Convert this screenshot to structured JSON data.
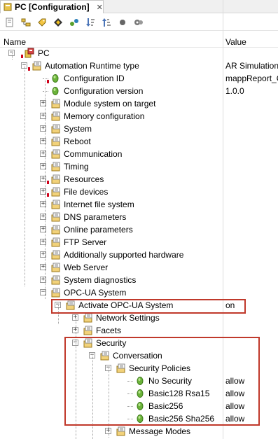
{
  "tab": {
    "title": "PC [Configuration]",
    "close": "✕"
  },
  "toolbar": {
    "icons": [
      "view-icon",
      "tree-icon",
      "tag-icon",
      "properties-icon",
      "connect-icon",
      "sort-down-icon",
      "sort-up-icon",
      "circle-icon",
      "gears-icon"
    ]
  },
  "columns": {
    "name": "Name",
    "value": "Value"
  },
  "rows": [
    {
      "label": "PC",
      "value": "",
      "depth": 0,
      "exp": "-",
      "icon": "pc"
    },
    {
      "label": "Automation Runtime type",
      "value": "AR Simulation",
      "depth": 2,
      "exp": "-",
      "icon": "folder"
    },
    {
      "label": "Configuration ID",
      "value": "mappReport_Co",
      "depth": 3,
      "exp": "",
      "icon": "green"
    },
    {
      "label": "Configuration version",
      "value": "1.0.0",
      "depth": 3,
      "exp": "",
      "icon": "green"
    },
    {
      "label": "Module system on target",
      "value": "",
      "depth": 3,
      "exp": "+",
      "icon": "folder"
    },
    {
      "label": "Memory configuration",
      "value": "",
      "depth": 3,
      "exp": "+",
      "icon": "folder"
    },
    {
      "label": "System",
      "value": "",
      "depth": 3,
      "exp": "+",
      "icon": "folder"
    },
    {
      "label": "Reboot",
      "value": "",
      "depth": 3,
      "exp": "+",
      "icon": "folder"
    },
    {
      "label": "Communication",
      "value": "",
      "depth": 3,
      "exp": "+",
      "icon": "folder"
    },
    {
      "label": "Timing",
      "value": "",
      "depth": 3,
      "exp": "+",
      "icon": "folder"
    },
    {
      "label": "Resources",
      "value": "",
      "depth": 3,
      "exp": "+",
      "icon": "folder"
    },
    {
      "label": "File devices",
      "value": "",
      "depth": 3,
      "exp": "+",
      "icon": "folder"
    },
    {
      "label": "Internet file system",
      "value": "",
      "depth": 3,
      "exp": "+",
      "icon": "folder"
    },
    {
      "label": "DNS parameters",
      "value": "",
      "depth": 3,
      "exp": "+",
      "icon": "folder"
    },
    {
      "label": "Online parameters",
      "value": "",
      "depth": 3,
      "exp": "+",
      "icon": "folder"
    },
    {
      "label": "FTP Server",
      "value": "",
      "depth": 3,
      "exp": "+",
      "icon": "folder"
    },
    {
      "label": "Additionally supported hardware",
      "value": "",
      "depth": 3,
      "exp": "+",
      "icon": "folder"
    },
    {
      "label": "Web Server",
      "value": "",
      "depth": 3,
      "exp": "+",
      "icon": "folder"
    },
    {
      "label": "System diagnostics",
      "value": "",
      "depth": 3,
      "exp": "+",
      "icon": "folder"
    },
    {
      "label": "OPC-UA System",
      "value": "",
      "depth": 3,
      "exp": "-",
      "icon": "folder"
    },
    {
      "label": "Activate OPC-UA System",
      "value": "on",
      "depth": 4,
      "exp": "-",
      "icon": "folder"
    },
    {
      "label": "Network Settings",
      "value": "",
      "depth": 5,
      "exp": "+",
      "icon": "folder"
    },
    {
      "label": "Facets",
      "value": "",
      "depth": 5,
      "exp": "+",
      "icon": "folder"
    },
    {
      "label": "Security",
      "value": "",
      "depth": 5,
      "exp": "-",
      "icon": "folder"
    },
    {
      "label": "Conversation",
      "value": "",
      "depth": 6,
      "exp": "-",
      "icon": "folder"
    },
    {
      "label": "Security Policies",
      "value": "",
      "depth": 7,
      "exp": "-",
      "icon": "folder"
    },
    {
      "label": "No Security",
      "value": "allow",
      "depth": 8,
      "exp": "",
      "icon": "green"
    },
    {
      "label": "Basic128 Rsa15",
      "value": "allow",
      "depth": 8,
      "exp": "",
      "icon": "green"
    },
    {
      "label": "Basic256",
      "value": "allow",
      "depth": 8,
      "exp": "",
      "icon": "green"
    },
    {
      "label": "Basic256 Sha256",
      "value": "allow",
      "depth": 8,
      "exp": "",
      "icon": "green"
    },
    {
      "label": "Message Modes",
      "value": "",
      "depth": 7,
      "exp": "+",
      "icon": "folder"
    }
  ],
  "colors": {
    "highlight": "#c0392b",
    "treeLine": "#a0a0a0"
  }
}
